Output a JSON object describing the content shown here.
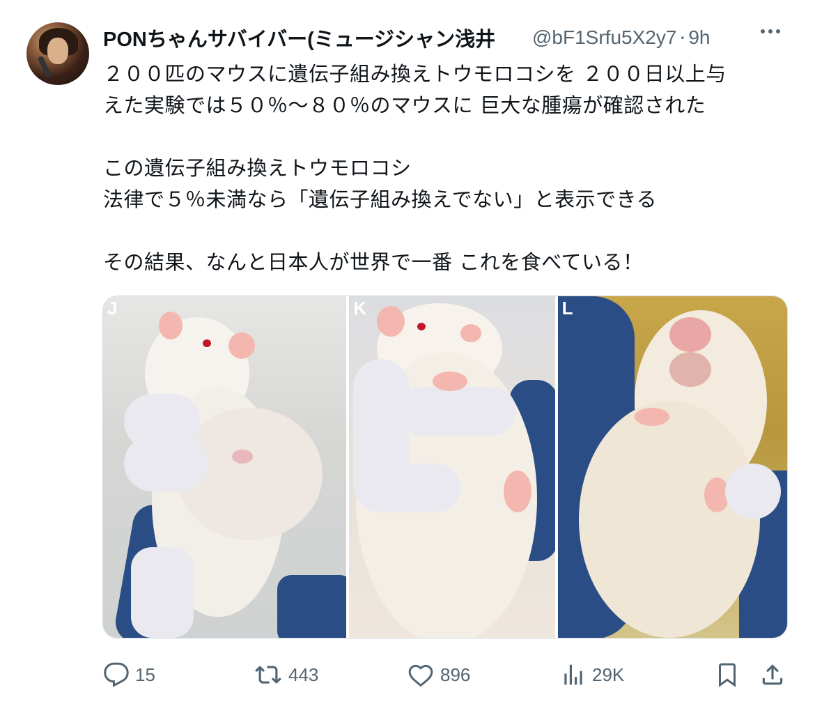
{
  "author": {
    "display_name": "PONちゃんサバイバー(ミュージシャン浅井",
    "handle": "@bF1Srfu5X2y7",
    "separator": "·",
    "time": "9h"
  },
  "body": {
    "lines": [
      "２００匹のマウスに遺伝子組み換えトウモロコシを ２００日以上与",
      "えた実験では５０％〜８０％のマウスに 巨大な腫瘍が確認された",
      "",
      "この遺伝子組み換えトウモロコシ",
      "法律で５％未満なら「遺伝子組み換えでない」と表示できる",
      "",
      "その結果、なんと日本人が世界で一番 これを食べている！"
    ]
  },
  "media": {
    "panels": [
      {
        "label": "J"
      },
      {
        "label": "K"
      },
      {
        "label": "L"
      }
    ]
  },
  "actions": {
    "reply_count": "15",
    "retweet_count": "443",
    "like_count": "896",
    "view_count": "29K"
  },
  "icons": [
    "more-icon",
    "reply-icon",
    "retweet-icon",
    "like-icon",
    "views-icon",
    "bookmark-icon",
    "share-icon"
  ],
  "colors": {
    "text_primary": "#0f1419",
    "text_secondary": "#536471",
    "border": "#cfd9de"
  }
}
